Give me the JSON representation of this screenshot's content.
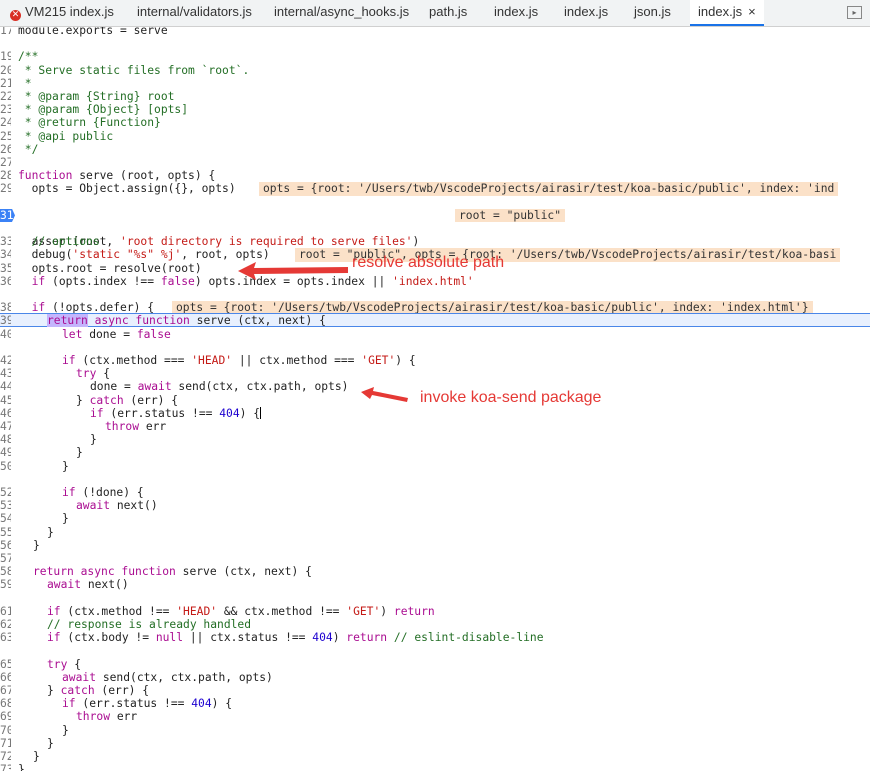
{
  "tabs": [
    {
      "label": "VM215 index.js",
      "error": true
    },
    {
      "label": "internal/validators.js"
    },
    {
      "label": "internal/async_hooks.js"
    },
    {
      "label": "path.js"
    },
    {
      "label": "index.js"
    },
    {
      "label": "index.js"
    },
    {
      "label": "json.js"
    },
    {
      "label": "index.js",
      "active": true,
      "close": "×"
    }
  ],
  "panel_toggle_icon": "▸",
  "gutter": {
    "l17": "17",
    "l19": "19",
    "l20": "20",
    "l21": "21",
    "l22": "22",
    "l23": "23",
    "l24": "24",
    "l25": "25",
    "l26": "26",
    "l27": "27",
    "l28": "28",
    "l29": "29",
    "l31": "31",
    "l33": "33",
    "l34": "34",
    "l35": "35",
    "l36": "36",
    "l38": "38",
    "l39": "39",
    "l40": "40",
    "l42": "42",
    "l43": "43",
    "l44": "44",
    "l45": "45",
    "l46": "46",
    "l47": "47",
    "l48": "48",
    "l49": "49",
    "l50": "50",
    "l52": "52",
    "l53": "53",
    "l54": "54",
    "l55": "55",
    "l56": "56",
    "l57": "57",
    "l58": "58",
    "l59": "59",
    "l61": "61",
    "l62": "62",
    "l63": "63",
    "l65": "65",
    "l66": "66",
    "l67": "67",
    "l68": "68",
    "l69": "69",
    "l70": "70",
    "l71": "71",
    "l72": "72",
    "l73": "73"
  },
  "code": {
    "l17": "module.exports = serve",
    "l19": "/**",
    "l20": " * Serve static files from `root`.",
    "l21": " *",
    "l22": " * @param {String} root",
    "l23": " * @param {Object} [opts]",
    "l24": " * @return {Function}",
    "l25": " * @api public",
    "l26": " */",
    "l28_kw": "function",
    "l28_rest": " serve (root, opts) {",
    "l29": "  opts = Object.assign({}, opts)",
    "l31": "  assert(root, ",
    "l31_str": "'root directory is required to serve files'",
    "l31_end": ")",
    "l33": "  // options",
    "l34_a": "  debug(",
    "l34_str": "'static \"%s\" %j'",
    "l34_b": ", root, opts)",
    "l35": "  opts.root = resolve(root)",
    "l36_a": "  ",
    "l36_kw": "if",
    "l36_b": " (opts.index !== ",
    "l36_false": "false",
    "l36_c": ") opts.index = opts.index || ",
    "l36_str": "'index.html'",
    "l38_a": "  ",
    "l38_kw": "if",
    "l38_b": " (!opts.defer) {",
    "l39_ret": "return",
    "l39_async": " async ",
    "l39_fn": "function",
    "l39_rest": " serve (ctx, next) {",
    "l40_kw": "let",
    "l40_rest": " done = ",
    "l40_false": "false",
    "l42_kw": "if",
    "l42_a": " (ctx.method === ",
    "l42_s1": "'HEAD'",
    "l42_b": " || ctx.method === ",
    "l42_s2": "'GET'",
    "l42_c": ") {",
    "l43": "try",
    "l43_rest": " {",
    "l44_a": "done = ",
    "l44_kw": "await",
    "l44_b": " send(ctx, ctx.path, opts)",
    "l45_a": "} ",
    "l45_kw": "catch",
    "l45_b": " (err) {",
    "l46_kw": "if",
    "l46_a": " (err.status !== ",
    "l46_num": "404",
    "l46_b": ") {",
    "l47_kw": "throw",
    "l47_rest": " err",
    "l48": "}",
    "l49": "}",
    "l50": "}",
    "l52_kw": "if",
    "l52_rest": " (!done) {",
    "l53_kw": "await",
    "l53_rest": " next()",
    "l54": "}",
    "l55": "}",
    "l56": "}",
    "l58_ret": "return",
    "l58_async": " async ",
    "l58_fn": "function",
    "l58_rest": " serve (ctx, next) {",
    "l59_kw": "await",
    "l59_rest": " next()",
    "l61_kw": "if",
    "l61_a": " (ctx.method !== ",
    "l61_s1": "'HEAD'",
    "l61_b": " && ctx.method !== ",
    "l61_s2": "'GET'",
    "l61_c": ") ",
    "l61_ret": "return",
    "l62": "// response is already handled",
    "l63_kw": "if",
    "l63_a": " (ctx.body != ",
    "l63_null": "null",
    "l63_b": " || ctx.status !== ",
    "l63_num": "404",
    "l63_c": ") ",
    "l63_ret": "return",
    "l63_cm": " // eslint-disable-line",
    "l65_kw": "try",
    "l65_rest": " {",
    "l66_kw": "await",
    "l66_rest": " send(ctx, ctx.path, opts)",
    "l67_a": "} ",
    "l67_kw": "catch",
    "l67_b": " (err) {",
    "l68_kw": "if",
    "l68_a": " (err.status !== ",
    "l68_num": "404",
    "l68_b": ") {",
    "l69_kw": "throw",
    "l69_rest": " err",
    "l70": "}",
    "l71": "}",
    "l72": "}",
    "l73": "}"
  },
  "inline_values": {
    "l29": "opts = {root: '/Users/twb/VscodeProjects/airasir/test/koa-basic/public', index: 'ind",
    "l31": "root = \"public\"",
    "l34": "root = \"public\", opts = {root: '/Users/twb/VscodeProjects/airasir/test/koa-basi",
    "l38": "opts = {root: '/Users/twb/VscodeProjects/airasir/test/koa-basic/public', index: 'index.html'}"
  },
  "annotations": {
    "resolve": "resolve absolute path",
    "invoke": "invoke koa-send package"
  },
  "colors": {
    "annotation": "#e53935",
    "breakpoint": "#3b82f6",
    "inline_bg": "#fbe1c8"
  }
}
